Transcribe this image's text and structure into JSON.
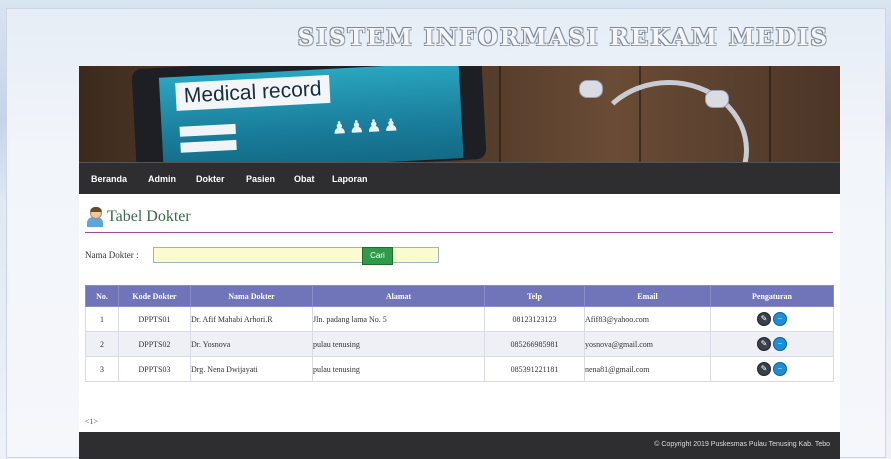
{
  "header": {
    "site_title": "SISTEM INFORMASI REKAM MEDIS"
  },
  "banner": {
    "record_label": "Medical record"
  },
  "nav": {
    "items": [
      {
        "id": "beranda",
        "label": "Beranda"
      },
      {
        "id": "admin",
        "label": "Admin"
      },
      {
        "id": "dokter",
        "label": "Dokter"
      },
      {
        "id": "pasien",
        "label": "Pasien"
      },
      {
        "id": "obat",
        "label": "Obat"
      },
      {
        "id": "laporan",
        "label": "Laporan"
      }
    ]
  },
  "page": {
    "title": "Tabel Dokter"
  },
  "search": {
    "label": "Nama Dokter :",
    "value": "",
    "button_label": "Cari"
  },
  "table": {
    "headers": [
      "No.",
      "Kode Dokter",
      "Nama Dokter",
      "Alamat",
      "Telp",
      "Email",
      "Pengaturan"
    ],
    "rows": [
      {
        "no": "1",
        "kode": "DPPTS01",
        "nama": "Dr. Afif Mahabi Arhori.R",
        "alamat": "Jln. padang lama No. 5",
        "telp": "08123123123",
        "email": "Afif83@yahoo.com"
      },
      {
        "no": "2",
        "kode": "DPPTS02",
        "nama": "Dr. Yosnova",
        "alamat": "pulau tenusing",
        "telp": "085266985981",
        "email": "yosnova@gmail.com"
      },
      {
        "no": "3",
        "kode": "DPPTS03",
        "nama": "Drg. Nena Dwijayati",
        "alamat": "pulau tenusing",
        "telp": "085391221181",
        "email": "nena81@gmail.com"
      }
    ]
  },
  "pager": {
    "text": "<1>"
  },
  "footer": {
    "copyright": "© Copyright 2019 Puskesmas Pulau Tenusing Kab. Tebo"
  },
  "icons": {
    "edit": "edit-icon",
    "delete": "delete-icon"
  },
  "colors": {
    "table_header": "#7074b8",
    "nav_bg": "#2e2e30",
    "accent_line": "#a04aa0",
    "search_button": "#2e9a4a"
  }
}
